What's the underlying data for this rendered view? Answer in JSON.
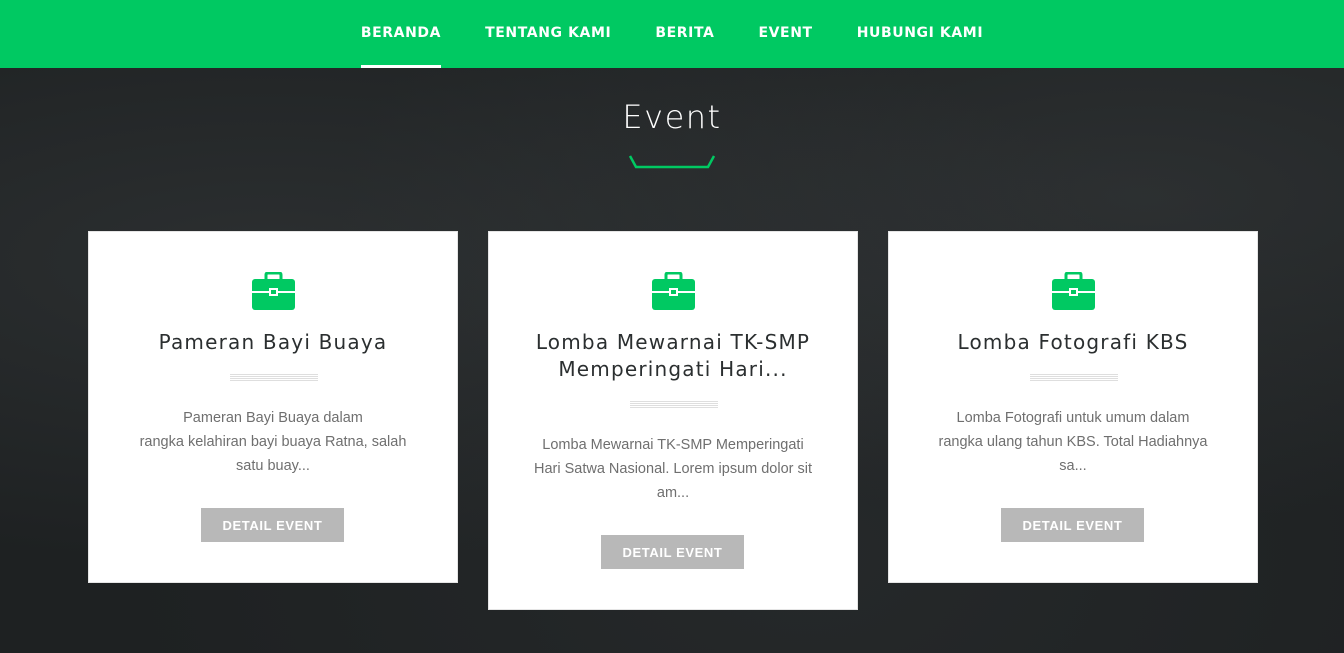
{
  "nav": {
    "items": [
      {
        "label": "BERANDA",
        "active": true
      },
      {
        "label": "TENTANG KAMI",
        "active": false
      },
      {
        "label": "BERITA",
        "active": false
      },
      {
        "label": "EVENT",
        "active": false
      },
      {
        "label": "HUBUNGI KAMI",
        "active": false
      }
    ]
  },
  "section": {
    "title": "Event"
  },
  "events": [
    {
      "icon": "briefcase-icon",
      "title": "Pameran Bayi Buaya",
      "desc_lines": [
        "Pameran Bayi Buaya dalam",
        "rangka kelahiran bayi buaya Ratna, salah",
        "satu buay..."
      ],
      "button": "DETAIL EVENT"
    },
    {
      "icon": "briefcase-icon",
      "title_lines": [
        "Lomba Mewarnai TK-SMP",
        "Memperingati Hari..."
      ],
      "desc_lines": [
        "Lomba Mewarnai TK-SMP Memperingati",
        "Hari Satwa Nasional. Lorem ipsum dolor sit",
        "am..."
      ],
      "button": "DETAIL EVENT"
    },
    {
      "icon": "briefcase-icon",
      "title": "Lomba Fotografi KBS",
      "desc_lines": [
        "Lomba Fotografi untuk umum dalam",
        "rangka ulang tahun KBS. Total Hadiahnya",
        "sa..."
      ],
      "button": "DETAIL EVENT"
    }
  ],
  "colors": {
    "accent": "#00c962",
    "background": "#1e2122",
    "button": "#b8b8b8",
    "card": "#ffffff"
  }
}
